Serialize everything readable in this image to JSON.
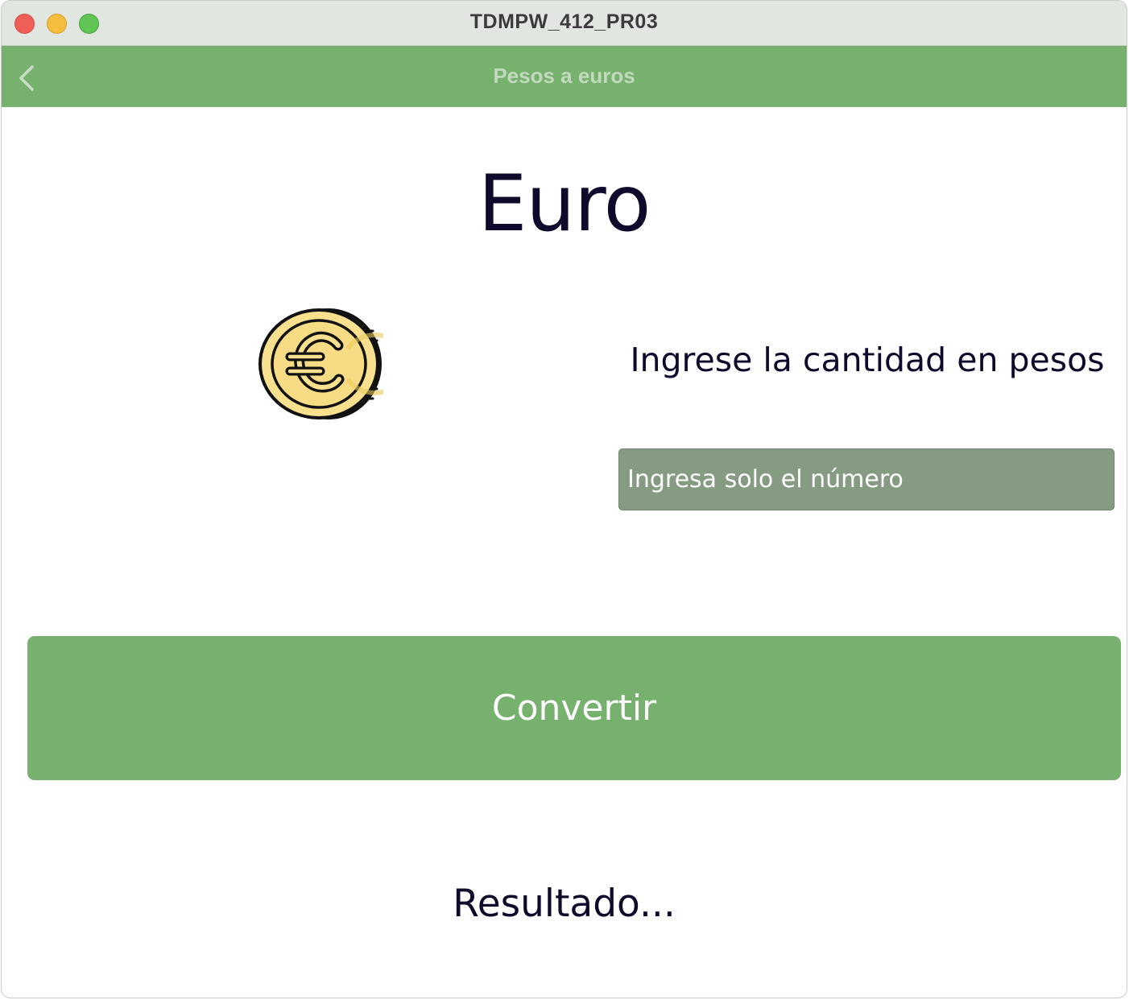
{
  "window": {
    "title": "TDMPW_412_PR03"
  },
  "navbar": {
    "title": "Pesos a euros",
    "back_icon": "chevron-left-icon"
  },
  "main": {
    "heading": "Euro",
    "coin_icon": "euro-coin-icon",
    "prompt": "Ingrese la cantidad en pesos",
    "amount_input": {
      "value": "",
      "placeholder": "Ingresa solo el número"
    },
    "convert_label": "Convertir",
    "result_text": "Resultado..."
  },
  "colors": {
    "accent_green": "#76b26d",
    "input_background": "#859b82",
    "text_dark": "#0d0a2b",
    "coin_gold": "#f8e08e"
  }
}
